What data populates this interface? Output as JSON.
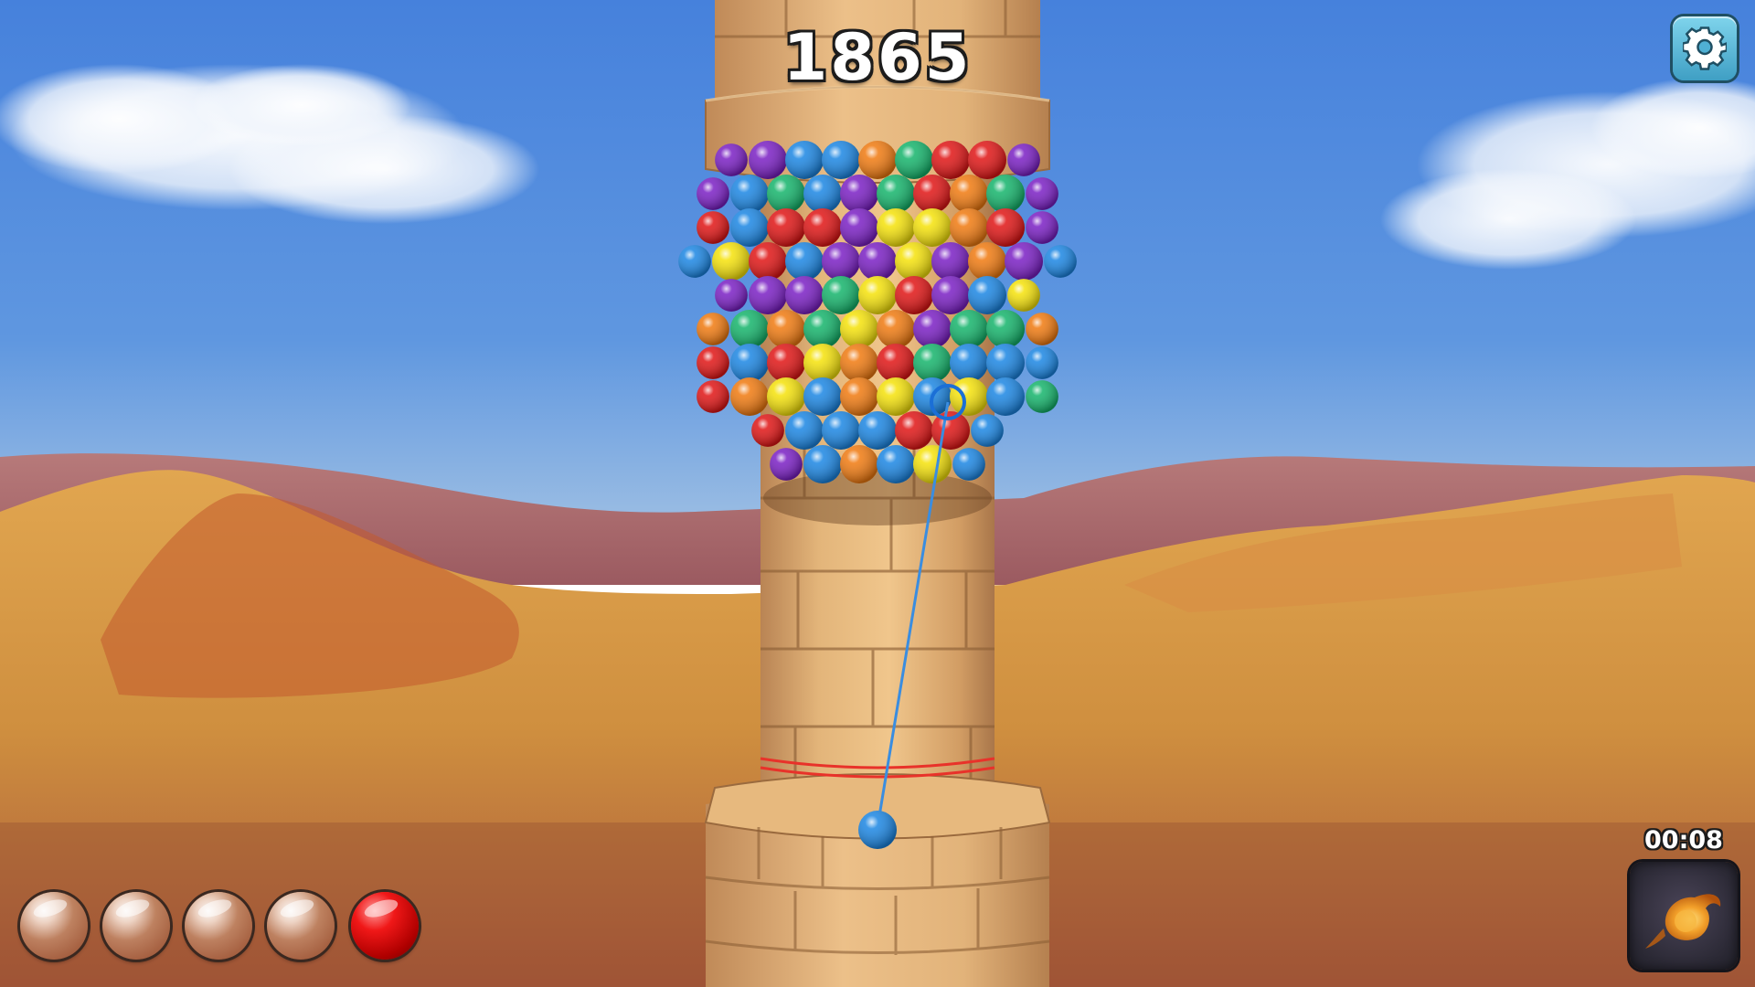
{
  "hud": {
    "score": "1865",
    "timer": "00:08",
    "settings_icon": "gear-icon",
    "powerup_icon": "fireball-icon"
  },
  "ammo": [
    {
      "state": "empty"
    },
    {
      "state": "empty"
    },
    {
      "state": "empty"
    },
    {
      "state": "empty"
    },
    {
      "state": "filled",
      "color": "red"
    }
  ],
  "shooter": {
    "ball_color": "blue"
  },
  "palette": {
    "red": "#e01515",
    "blue": "#1b86e3",
    "yellow": "#f5e20a",
    "green": "#14b46b",
    "purple": "#7a1fc4",
    "orange": "#f07a10",
    "sky_top": "#4a86dc",
    "sky_bottom": "#9fc0e6",
    "sand": "#d99a45",
    "stone": "#d9a86c",
    "danger_line": "#e8322a"
  },
  "tower_balls": {
    "rows": [
      [
        "purple",
        "purple",
        "blue",
        "blue",
        "orange",
        "green",
        "red",
        "red",
        "purple"
      ],
      [
        "purple",
        "blue",
        "green",
        "blue",
        "purple",
        "green",
        "red",
        "orange",
        "green",
        "purple"
      ],
      [
        "red",
        "blue",
        "red",
        "red",
        "purple",
        "yellow",
        "yellow",
        "orange",
        "red",
        "purple"
      ],
      [
        "blue",
        "yellow",
        "red",
        "blue",
        "purple",
        "purple",
        "yellow",
        "purple",
        "orange",
        "purple",
        "blue"
      ],
      [
        "purple",
        "purple",
        "purple",
        "green",
        "yellow",
        "red",
        "purple",
        "blue",
        "yellow"
      ],
      [
        "orange",
        "green",
        "orange",
        "green",
        "yellow",
        "orange",
        "purple",
        "green",
        "green",
        "orange"
      ],
      [
        "red",
        "blue",
        "red",
        "yellow",
        "orange",
        "red",
        "green",
        "blue",
        "blue",
        "blue"
      ],
      [
        "red",
        "orange",
        "yellow",
        "blue",
        "orange",
        "yellow",
        "blue",
        "yellow",
        "blue",
        "green"
      ],
      [
        "red",
        "blue",
        "blue",
        "blue",
        "red",
        "red",
        "blue"
      ],
      [
        "purple",
        "blue",
        "orange",
        "blue",
        "yellow",
        "blue"
      ]
    ]
  }
}
